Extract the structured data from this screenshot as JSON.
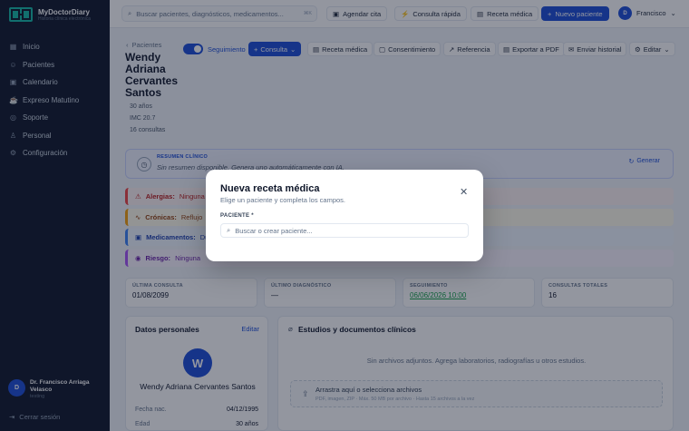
{
  "app": {
    "name": "MyDoctorDiary",
    "tagline": "Historia clínica electrónica"
  },
  "sidebar": {
    "items": [
      {
        "label": "Inicio",
        "icon": "grid-icon"
      },
      {
        "label": "Pacientes",
        "icon": "users-icon"
      },
      {
        "label": "Calendario",
        "icon": "calendar-icon"
      },
      {
        "label": "Expreso Matutino",
        "icon": "coffee-icon"
      },
      {
        "label": "Soporte",
        "icon": "lifebuoy-icon"
      },
      {
        "label": "Personal",
        "icon": "person-icon"
      },
      {
        "label": "Configuración",
        "icon": "gear-icon"
      }
    ],
    "user": {
      "initial": "D",
      "name": "Dr. Francisco Arriaga Velasco",
      "role": "testing"
    },
    "logout": "Cerrar sesión"
  },
  "topbar": {
    "search_placeholder": "Buscar pacientes, diagnósticos, medicamentos...",
    "shortcut": "⌘K",
    "agendar": "Agendar cita",
    "consulta_rapida": "Consulta rápida",
    "receta": "Receta médica",
    "nuevo_paciente": "Nuevo paciente",
    "user_initial": "D",
    "user_name": "Francisco"
  },
  "patient": {
    "back": "Pacientes",
    "name": "Wendy Adriana Cervantes Santos",
    "age": "30 años",
    "imc": "IMC 20.7",
    "consultas": "16 consultas",
    "seguimiento_label": "Seguimiento",
    "actions": {
      "consulta": "Consulta",
      "receta": "Receta médica",
      "consentimiento": "Consentimiento",
      "referencia": "Referencia",
      "exportar": "Exportar a PDF",
      "historial": "Enviar historial",
      "editar": "Editar"
    },
    "summary": {
      "title": "RESUMEN CLÍNICO",
      "text": "Sin resumen disponible. Genera uno automáticamente con IA.",
      "generate": "Generar"
    },
    "alerts": [
      {
        "label": "Alergias:",
        "value": "Ninguna"
      },
      {
        "label": "Crónicas:",
        "value": "Reflujo"
      },
      {
        "label": "Medicamentos:",
        "value": "Dul"
      },
      {
        "label": "Riesgo:",
        "value": "Ninguna"
      }
    ],
    "stats": [
      {
        "label": "ÚLTIMA CONSULTA",
        "value": "01/08/2099"
      },
      {
        "label": "ÚLTIMO DIAGNÓSTICO",
        "value": "—"
      },
      {
        "label": "SEGUIMIENTO",
        "value": "06/06/2026 10:00"
      },
      {
        "label": "CONSULTAS TOTALES",
        "value": "16"
      }
    ],
    "personal": {
      "title": "Datos personales",
      "edit": "Editar",
      "initial": "W",
      "full_name": "Wendy Adriana Cervantes Santos",
      "rows": [
        {
          "label": "Fecha nac.",
          "value": "04/12/1995"
        },
        {
          "label": "Edad",
          "value": "30 años"
        }
      ]
    },
    "studies": {
      "title": "Estudios y documentos clínicos",
      "empty": "Sin archivos adjuntos. Agrega laboratorios, radiografías u otros estudios.",
      "upload_title": "Arrastra aquí o selecciona archivos",
      "upload_hint": "PDF, imagen, ZIP · Máx. 50 MB por archivo · Hasta 15 archivos a la vez"
    }
  },
  "modal": {
    "title": "Nueva receta médica",
    "subtitle": "Elige un paciente y completa los campos.",
    "field_label": "PACIENTE *",
    "field_placeholder": "Buscar o crear paciente..."
  }
}
